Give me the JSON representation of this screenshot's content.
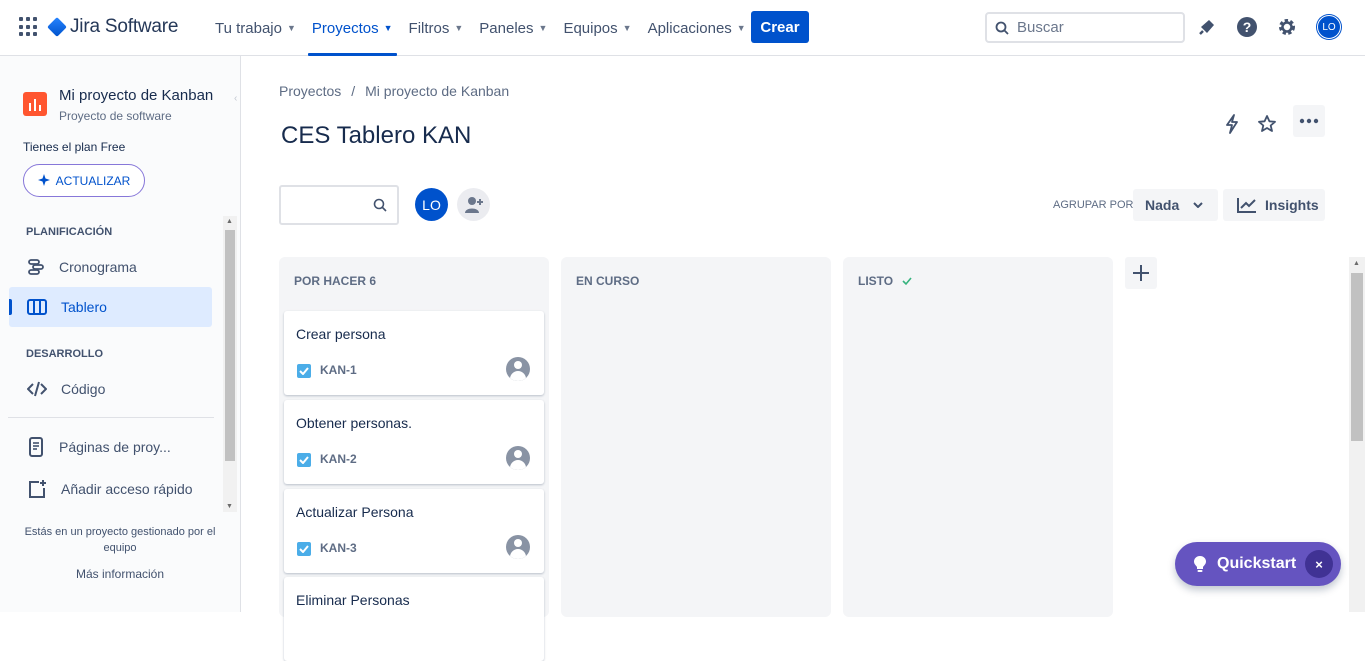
{
  "app": {
    "name": "Jira Software"
  },
  "nav": {
    "items": [
      {
        "label": "Tu trabajo"
      },
      {
        "label": "Proyectos"
      },
      {
        "label": "Filtros"
      },
      {
        "label": "Paneles"
      },
      {
        "label": "Equipos"
      },
      {
        "label": "Aplicaciones"
      }
    ],
    "create_label": "Crear",
    "search_placeholder": "Buscar",
    "user_initials": "LO"
  },
  "sidebar": {
    "project_name": "Mi proyecto de Kanban",
    "project_type": "Proyecto de software",
    "plan_text": "Tienes el plan Free",
    "upgrade_label": "ACTUALIZAR",
    "planning_title": "PLANIFICACIÓN",
    "planning_items": [
      {
        "label": "Cronograma"
      },
      {
        "label": "Tablero"
      }
    ],
    "development_title": "DESARROLLO",
    "development_items": [
      {
        "label": "Código"
      }
    ],
    "extra_items": [
      {
        "label": "Páginas de proy..."
      },
      {
        "label": "Añadir acceso rápido"
      }
    ],
    "footer_text": "Estás en un proyecto gestionado por el equipo",
    "more_info": "Más información"
  },
  "breadcrumb": [
    "Proyectos",
    "/",
    "Mi proyecto de Kanban"
  ],
  "page_title": "CES Tablero KAN",
  "toolbar": {
    "user_initials": "LO",
    "group_by_label": "AGRUPAR POR",
    "group_by_value": "Nada",
    "insights_label": "Insights"
  },
  "columns": [
    {
      "title": "POR HACER 6",
      "cards": [
        {
          "title": "Crear persona",
          "key": "KAN-1"
        },
        {
          "title": "Obtener personas.",
          "key": "KAN-2"
        },
        {
          "title": "Actualizar Persona",
          "key": "KAN-3"
        },
        {
          "title": "Eliminar Personas",
          "key": ""
        }
      ]
    },
    {
      "title": "EN CURSO",
      "cards": []
    },
    {
      "title": "LISTO",
      "cards": []
    }
  ],
  "quickstart": {
    "label": "Quickstart",
    "close": "×"
  },
  "colors": {
    "brand": "#0052cc",
    "quickstart": "#6554c0",
    "project_icon": "#ff5630",
    "done_check": "#36b37e"
  }
}
